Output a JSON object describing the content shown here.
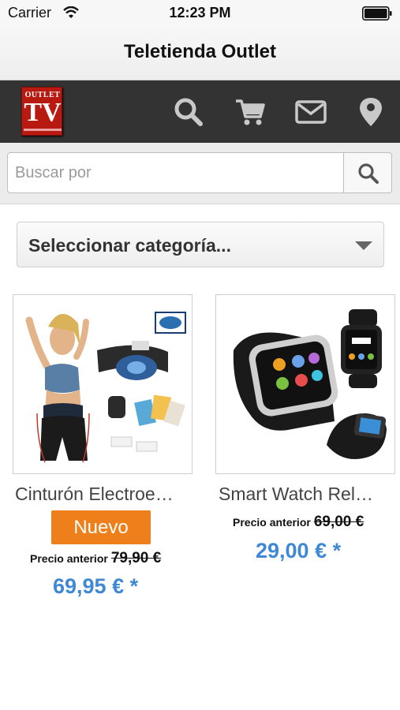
{
  "status_bar": {
    "carrier": "Carrier",
    "time": "12:23 PM"
  },
  "nav": {
    "title": "Teletienda Outlet"
  },
  "header": {
    "logo_top": "OUTLET",
    "logo_main": "TV",
    "icons": [
      "search-icon",
      "cart-icon",
      "envelope-icon",
      "location-pin-icon"
    ],
    "background": "#333333"
  },
  "search": {
    "placeholder": "Buscar por",
    "value": ""
  },
  "category": {
    "selected": "Seleccionar categoría..."
  },
  "products": [
    {
      "name": "Cinturón Electroe…",
      "badge": "Nuevo",
      "previous_label": "Precio anterior",
      "previous_price": "79,90 €",
      "price": "69,95 € *"
    },
    {
      "name": "Smart Watch Rel…",
      "previous_label": "Precio anterior",
      "previous_price": "69,00 €",
      "price": "29,00 € *"
    }
  ],
  "colors": {
    "accent_price": "#3f88d6",
    "badge": "#ef7f1a",
    "logo": "#b81a12"
  }
}
